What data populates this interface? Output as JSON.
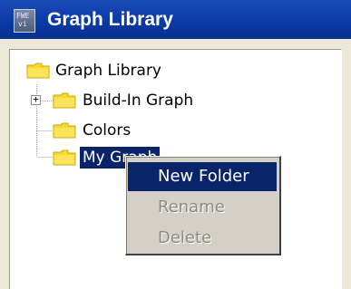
{
  "window": {
    "title": "Graph Library",
    "app_icon_text_top": "FWE",
    "app_icon_text_bottom": "vi"
  },
  "tree": {
    "root": {
      "label": "Graph Library",
      "icon": "folder-icon"
    },
    "children": [
      {
        "label": "Build-In Graph",
        "icon": "folder-icon",
        "expander": "+"
      },
      {
        "label": "Colors",
        "icon": "folder-icon"
      },
      {
        "label": "My Graph",
        "icon": "folder-icon",
        "selected": true
      }
    ]
  },
  "context_menu": {
    "items": [
      {
        "label": "New Folder",
        "state": "highlighted"
      },
      {
        "label": "Rename",
        "state": "disabled"
      },
      {
        "label": "Delete",
        "state": "disabled"
      }
    ]
  },
  "colors": {
    "titlebar": "#0a3aa8",
    "selection": "#0a246a",
    "folder": "#f7d82b",
    "menu_bg": "#d4d0c8"
  }
}
